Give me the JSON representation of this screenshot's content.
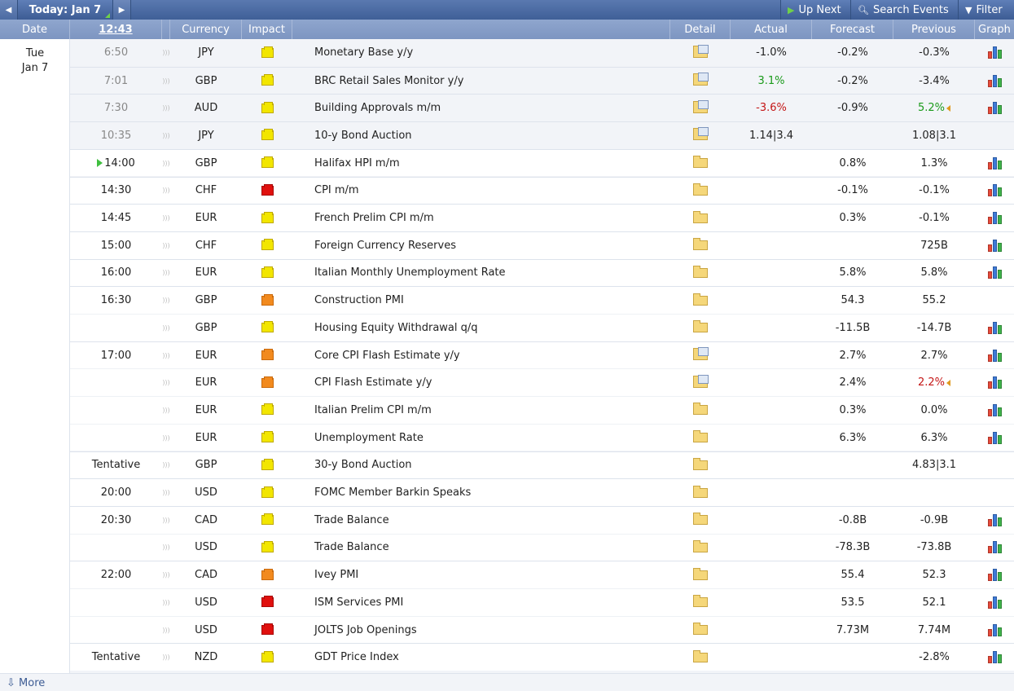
{
  "toolbar": {
    "prev_icon": "left-arrow",
    "next_icon": "right-arrow",
    "today_label": "Today: Jan 7",
    "up_next_label": "Up Next",
    "search_label": "Search Events",
    "filter_label": "Filter"
  },
  "header": {
    "date": "Date",
    "time": "12:43",
    "currency": "Currency",
    "impact": "Impact",
    "detail": "Detail",
    "actual": "Actual",
    "forecast": "Forecast",
    "previous": "Previous",
    "graph": "Graph"
  },
  "date": {
    "day": "Tue",
    "date": "Jan 7"
  },
  "colors": {
    "positive": "#1a9a1a",
    "negative": "#c41616",
    "header": "#7d95c1",
    "accent": "#3d5c94"
  },
  "events": [
    {
      "time": "6:50",
      "currency": "JPY",
      "impact": "yellow",
      "event": "Monetary Base y/y",
      "actual": "-1.0%",
      "actual_class": "",
      "forecast": "-0.2%",
      "previous": "-0.3%",
      "previous_class": "",
      "revised": false,
      "graph": true,
      "detail": "doc",
      "past": true
    },
    {
      "time": "7:01",
      "currency": "GBP",
      "impact": "yellow",
      "event": "BRC Retail Sales Monitor y/y",
      "actual": "3.1%",
      "actual_class": "pos",
      "forecast": "-0.2%",
      "previous": "-3.4%",
      "previous_class": "",
      "revised": false,
      "graph": true,
      "detail": "doc",
      "past": true
    },
    {
      "time": "7:30",
      "currency": "AUD",
      "impact": "yellow",
      "event": "Building Approvals m/m",
      "actual": "-3.6%",
      "actual_class": "neg",
      "forecast": "-0.9%",
      "previous": "5.2%",
      "previous_class": "pos",
      "revised": true,
      "graph": true,
      "detail": "doc",
      "past": true
    },
    {
      "time": "10:35",
      "currency": "JPY",
      "impact": "yellow",
      "event": "10-y Bond Auction",
      "actual": "1.14|3.4",
      "actual_class": "",
      "forecast": "",
      "previous": "1.08|3.1",
      "previous_class": "",
      "revised": false,
      "graph": false,
      "detail": "doc",
      "past": true
    },
    {
      "time": "14:00",
      "currency": "GBP",
      "impact": "yellow",
      "event": "Halifax HPI m/m",
      "actual": "",
      "actual_class": "",
      "forecast": "0.8%",
      "previous": "1.3%",
      "previous_class": "",
      "revised": false,
      "graph": true,
      "detail": "plain",
      "past": false,
      "live": true
    },
    {
      "time": "14:30",
      "currency": "CHF",
      "impact": "red",
      "event": "CPI m/m",
      "actual": "",
      "actual_class": "",
      "forecast": "-0.1%",
      "previous": "-0.1%",
      "previous_class": "",
      "revised": false,
      "graph": true,
      "detail": "plain",
      "past": false
    },
    {
      "time": "14:45",
      "currency": "EUR",
      "impact": "yellow",
      "event": "French Prelim CPI m/m",
      "actual": "",
      "actual_class": "",
      "forecast": "0.3%",
      "previous": "-0.1%",
      "previous_class": "",
      "revised": false,
      "graph": true,
      "detail": "plain",
      "past": false
    },
    {
      "time": "15:00",
      "currency": "CHF",
      "impact": "yellow",
      "event": "Foreign Currency Reserves",
      "actual": "",
      "actual_class": "",
      "forecast": "",
      "previous": "725B",
      "previous_class": "",
      "revised": false,
      "graph": true,
      "detail": "plain",
      "past": false
    },
    {
      "time": "16:00",
      "currency": "EUR",
      "impact": "yellow",
      "event": "Italian Monthly Unemployment Rate",
      "actual": "",
      "actual_class": "",
      "forecast": "5.8%",
      "previous": "5.8%",
      "previous_class": "",
      "revised": false,
      "graph": true,
      "detail": "plain",
      "past": false
    },
    {
      "time": "16:30",
      "currency": "GBP",
      "impact": "orange",
      "event": "Construction PMI",
      "actual": "",
      "actual_class": "",
      "forecast": "54.3",
      "previous": "55.2",
      "previous_class": "",
      "revised": false,
      "graph": false,
      "detail": "plain",
      "past": false
    },
    {
      "time": "",
      "currency": "GBP",
      "impact": "yellow",
      "event": "Housing Equity Withdrawal q/q",
      "actual": "",
      "actual_class": "",
      "forecast": "-11.5B",
      "previous": "-14.7B",
      "previous_class": "",
      "revised": false,
      "graph": true,
      "detail": "plain",
      "past": false
    },
    {
      "time": "17:00",
      "currency": "EUR",
      "impact": "orange",
      "event": "Core CPI Flash Estimate y/y",
      "actual": "",
      "actual_class": "",
      "forecast": "2.7%",
      "previous": "2.7%",
      "previous_class": "",
      "revised": false,
      "graph": true,
      "detail": "doc",
      "past": false
    },
    {
      "time": "",
      "currency": "EUR",
      "impact": "orange",
      "event": "CPI Flash Estimate y/y",
      "actual": "",
      "actual_class": "",
      "forecast": "2.4%",
      "previous": "2.2%",
      "previous_class": "neg",
      "revised": true,
      "graph": true,
      "detail": "doc",
      "past": false
    },
    {
      "time": "",
      "currency": "EUR",
      "impact": "yellow",
      "event": "Italian Prelim CPI m/m",
      "actual": "",
      "actual_class": "",
      "forecast": "0.3%",
      "previous": "0.0%",
      "previous_class": "",
      "revised": false,
      "graph": true,
      "detail": "plain",
      "past": false
    },
    {
      "time": "",
      "currency": "EUR",
      "impact": "yellow",
      "event": "Unemployment Rate",
      "actual": "",
      "actual_class": "",
      "forecast": "6.3%",
      "previous": "6.3%",
      "previous_class": "",
      "revised": false,
      "graph": true,
      "detail": "plain",
      "past": false
    },
    {
      "time": "Tentative",
      "currency": "GBP",
      "impact": "yellow",
      "event": "30-y Bond Auction",
      "actual": "",
      "actual_class": "",
      "forecast": "",
      "previous": "4.83|3.1",
      "previous_class": "",
      "revised": false,
      "graph": false,
      "detail": "plain",
      "past": false
    },
    {
      "time": "20:00",
      "currency": "USD",
      "impact": "yellow",
      "event": "FOMC Member Barkin Speaks",
      "actual": "",
      "actual_class": "",
      "forecast": "",
      "previous": "",
      "previous_class": "",
      "revised": false,
      "graph": false,
      "detail": "plain",
      "past": false
    },
    {
      "time": "20:30",
      "currency": "CAD",
      "impact": "yellow",
      "event": "Trade Balance",
      "actual": "",
      "actual_class": "",
      "forecast": "-0.8B",
      "previous": "-0.9B",
      "previous_class": "",
      "revised": false,
      "graph": true,
      "detail": "plain",
      "past": false
    },
    {
      "time": "",
      "currency": "USD",
      "impact": "yellow",
      "event": "Trade Balance",
      "actual": "",
      "actual_class": "",
      "forecast": "-78.3B",
      "previous": "-73.8B",
      "previous_class": "",
      "revised": false,
      "graph": true,
      "detail": "plain",
      "past": false
    },
    {
      "time": "22:00",
      "currency": "CAD",
      "impact": "orange",
      "event": "Ivey PMI",
      "actual": "",
      "actual_class": "",
      "forecast": "55.4",
      "previous": "52.3",
      "previous_class": "",
      "revised": false,
      "graph": true,
      "detail": "plain",
      "past": false
    },
    {
      "time": "",
      "currency": "USD",
      "impact": "red",
      "event": "ISM Services PMI",
      "actual": "",
      "actual_class": "",
      "forecast": "53.5",
      "previous": "52.1",
      "previous_class": "",
      "revised": false,
      "graph": true,
      "detail": "plain",
      "past": false
    },
    {
      "time": "",
      "currency": "USD",
      "impact": "red",
      "event": "JOLTS Job Openings",
      "actual": "",
      "actual_class": "",
      "forecast": "7.73M",
      "previous": "7.74M",
      "previous_class": "",
      "revised": false,
      "graph": true,
      "detail": "plain",
      "past": false
    },
    {
      "time": "Tentative",
      "currency": "NZD",
      "impact": "yellow",
      "event": "GDT Price Index",
      "actual": "",
      "actual_class": "",
      "forecast": "",
      "previous": "-2.8%",
      "previous_class": "",
      "revised": false,
      "graph": true,
      "detail": "plain",
      "past": false
    }
  ],
  "footer": {
    "more_label": "More"
  }
}
